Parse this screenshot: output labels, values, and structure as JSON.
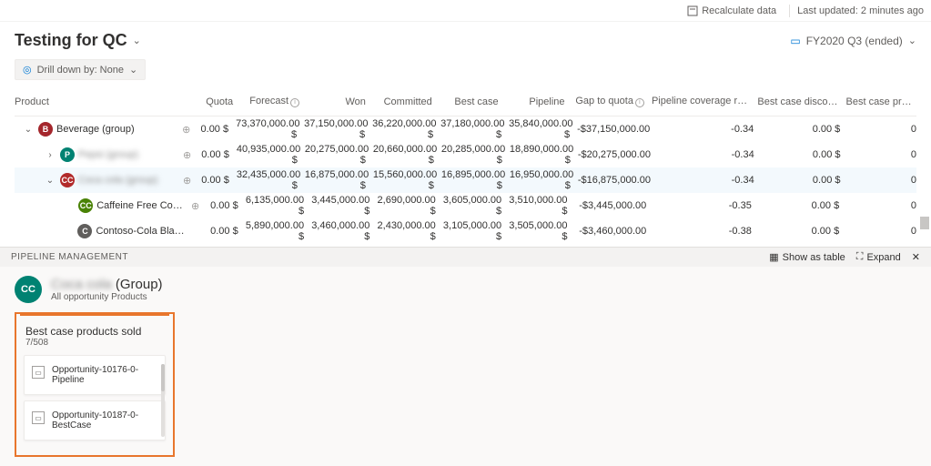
{
  "topbar": {
    "recalc": "Recalculate data",
    "updated": "Last updated: 2 minutes ago"
  },
  "title": "Testing for QC",
  "period": "FY2020 Q3 (ended)",
  "drill": "Drill down by: None",
  "headers": {
    "product": "Product",
    "quota": "Quota",
    "forecast": "Forecast",
    "won": "Won",
    "committed": "Committed",
    "bestcase": "Best case",
    "pipeline": "Pipeline",
    "gap": "Gap to quota",
    "ratio": "Pipeline coverage ratio",
    "disc": "Best case discount",
    "prod": "Best case prod..."
  },
  "rows": [
    {
      "ind": 0,
      "exp": "⌄",
      "bcls": "b-red",
      "bch": "B",
      "name": "Beverage (group)",
      "share": true,
      "quota": "0.00 $",
      "forecast": "73,370,000.00 $",
      "won": "37,150,000.00 $",
      "committed": "36,220,000.00 $",
      "bestcase": "37,180,000.00 $",
      "pipeline": "35,840,000.00 $",
      "gap": "-$37,150,000.00",
      "ratio": "-0.34",
      "disc": "0.00 $",
      "last": "0"
    },
    {
      "ind": 1,
      "exp": "›",
      "bcls": "b-teal",
      "bch": "P",
      "name": "Pepsi (group)",
      "blur": true,
      "share": true,
      "quota": "0.00 $",
      "forecast": "40,935,000.00 $",
      "won": "20,275,000.00 $",
      "committed": "20,660,000.00 $",
      "bestcase": "20,285,000.00 $",
      "pipeline": "18,890,000.00 $",
      "gap": "-$20,275,000.00",
      "ratio": "-0.34",
      "disc": "0.00 $",
      "last": "0"
    },
    {
      "ind": 1,
      "exp": "⌄",
      "bcls": "b-cc",
      "bch": "CC",
      "name": "Coca cola (group)",
      "blur": true,
      "share": true,
      "sel": true,
      "quota": "0.00 $",
      "forecast": "32,435,000.00 $",
      "won": "16,875,000.00 $",
      "committed": "15,560,000.00 $",
      "bestcase": "16,895,000.00 $",
      "pipeline": "16,950,000.00 $",
      "gap": "-$16,875,000.00",
      "ratio": "-0.34",
      "disc": "0.00 $",
      "last": "0"
    },
    {
      "ind": 2,
      "exp": "",
      "bcls": "b-green",
      "bch": "CC",
      "name": "Caffeine Free Contoso-Cola",
      "share": true,
      "quota": "0.00 $",
      "forecast": "6,135,000.00 $",
      "won": "3,445,000.00 $",
      "committed": "2,690,000.00 $",
      "bestcase": "3,605,000.00 $",
      "pipeline": "3,510,000.00 $",
      "gap": "-$3,445,000.00",
      "ratio": "-0.35",
      "disc": "0.00 $",
      "last": "0"
    },
    {
      "ind": 2,
      "exp": "",
      "bcls": "b-grey",
      "bch": "C",
      "name": "Contoso-Cola Black Cherry Va",
      "quota": "0.00 $",
      "forecast": "5,890,000.00 $",
      "won": "3,460,000.00 $",
      "committed": "2,430,000.00 $",
      "bestcase": "3,105,000.00 $",
      "pipeline": "3,505,000.00 $",
      "gap": "-$3,460,000.00",
      "ratio": "-0.38",
      "disc": "0.00 $",
      "last": "0"
    }
  ],
  "panel": {
    "title": "PIPELINE MANAGEMENT",
    "showtable": "Show as table",
    "expand": "Expand",
    "group_name": "Coca cola (Group)",
    "group_sub": "All opportunity Products",
    "card_title": "Best case products sold",
    "card_count": "7/508",
    "opps": [
      "Opportunity-10176-0-Pipeline",
      "Opportunity-10187-0-BestCase"
    ]
  }
}
